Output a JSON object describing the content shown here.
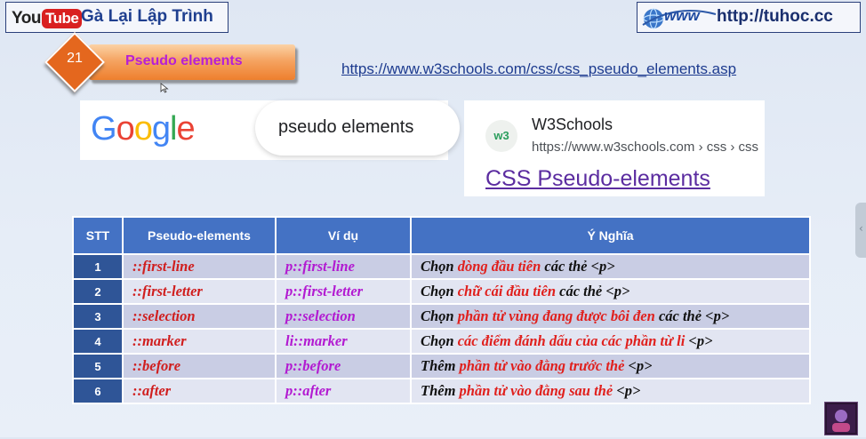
{
  "header": {
    "youtube_you": "You",
    "youtube_tube": "Tube",
    "channel_name": "Gà Lại Lập Trình",
    "website_icon_text": "www",
    "website_url": "http://tuhoc.cc"
  },
  "lesson": {
    "number": "21",
    "title": "Pseudo elements"
  },
  "reference_link": "https://www.w3schools.com/css/css_pseudo_elements.asp",
  "google": {
    "logo_letters": [
      "G",
      "o",
      "o",
      "g",
      "l",
      "e"
    ],
    "logo_colors": [
      "#4285F4",
      "#EA4335",
      "#FBBC05",
      "#4285F4",
      "#34A853",
      "#EA4335"
    ],
    "query": "pseudo elements"
  },
  "result": {
    "favicon_text": "w3",
    "site_name": "W3Schools",
    "breadcrumb": "https://www.w3schools.com › css › css",
    "title": "CSS Pseudo-elements"
  },
  "table": {
    "headers": [
      "STT",
      "Pseudo-elements",
      "Ví dụ",
      "Ý Nghĩa"
    ],
    "rows": [
      {
        "stt": "1",
        "pseudo": "::first-line",
        "example": "p::first-line",
        "meaning": {
          "before": "Chọn ",
          "highlight": "dòng đầu tiên",
          "after": " các thẻ <p>"
        }
      },
      {
        "stt": "2",
        "pseudo": "::first-letter",
        "example": "p::first-letter",
        "meaning": {
          "before": "Chọn ",
          "highlight": "chữ cái đầu tiên",
          "after": " các thẻ <p>"
        }
      },
      {
        "stt": "3",
        "pseudo": "::selection",
        "example": "p::selection",
        "meaning": {
          "before": "Chọn ",
          "highlight": "phần tử vùng đang được bôi đen",
          "after": " các thẻ <p>"
        }
      },
      {
        "stt": "4",
        "pseudo": "::marker",
        "example": "li::marker",
        "meaning": {
          "before": "Chọn ",
          "highlight": "các điểm đánh dấu của các phần từ li",
          "after": " <p>"
        }
      },
      {
        "stt": "5",
        "pseudo": "::before",
        "example": "p::before",
        "meaning": {
          "before": "Thêm ",
          "highlight": "phần tử vào đằng trước thẻ",
          "after": " <p>"
        }
      },
      {
        "stt": "6",
        "pseudo": "::after",
        "example": "p::after",
        "meaning": {
          "before": "Thêm ",
          "highlight": "phần tử vào đằng sau thẻ",
          "after": " <p>"
        }
      }
    ]
  },
  "colors": {
    "table_header": "#4472c4",
    "stt_cell": "#2f5597",
    "pseudo_text": "#d01e1e",
    "example_text": "#b21ad1",
    "highlight_text": "#e0201d",
    "lesson_title": "#b61fd6"
  }
}
